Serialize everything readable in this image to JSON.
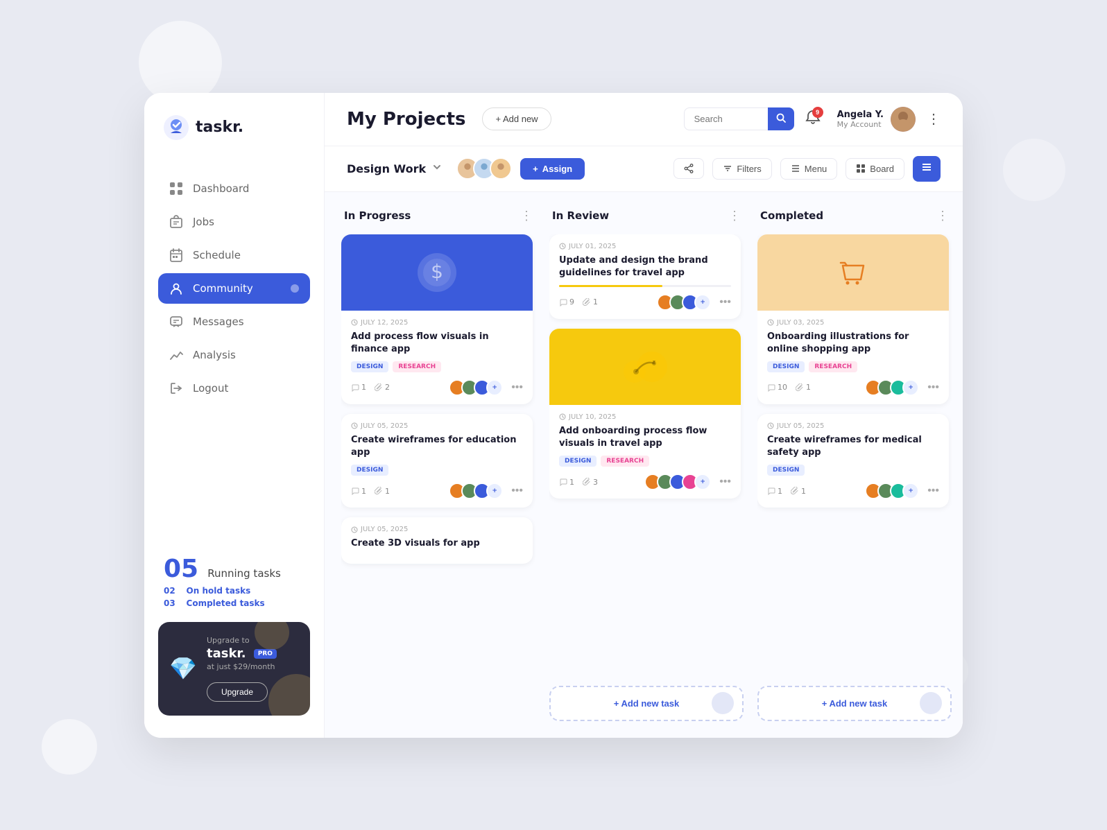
{
  "app": {
    "name": "taskr.",
    "logo_alt": "Taskr logo"
  },
  "header": {
    "page_title": "My Projects",
    "add_new_label": "+ Add new",
    "search_placeholder": "Search",
    "notification_count": "9",
    "user": {
      "name": "Angela Y.",
      "role": "My Account"
    }
  },
  "toolbar": {
    "project_name": "Design Work",
    "assign_label": "Assign",
    "filters_label": "Filters",
    "menu_label": "Menu",
    "board_label": "Board"
  },
  "sidebar": {
    "nav_items": [
      {
        "id": "dashboard",
        "label": "Dashboard",
        "active": false
      },
      {
        "id": "jobs",
        "label": "Jobs",
        "active": false
      },
      {
        "id": "schedule",
        "label": "Schedule",
        "active": false
      },
      {
        "id": "community",
        "label": "Community",
        "active": true
      },
      {
        "id": "messages",
        "label": "Messages",
        "active": false
      },
      {
        "id": "analysis",
        "label": "Analysis",
        "active": false
      },
      {
        "id": "logout",
        "label": "Logout",
        "active": false
      }
    ],
    "running_tasks": {
      "count": "05",
      "label": "Running tasks",
      "on_hold": "02",
      "on_hold_label": "On hold tasks",
      "completed": "03",
      "completed_label": "Completed tasks"
    },
    "upgrade": {
      "pre_text": "Upgrade to",
      "brand": "taskr.",
      "pro_badge": "PRO",
      "price": "at just $29/month",
      "button_label": "Upgrade"
    }
  },
  "columns": [
    {
      "id": "in-progress",
      "title": "In Progress",
      "cards": [
        {
          "id": "card1",
          "has_image": true,
          "image_type": "blue",
          "image_icon": "$",
          "date": "JULY 12, 2025",
          "title": "Add process flow visuals in finance app",
          "tags": [
            "Design",
            "Research"
          ],
          "stats": {
            "comments": "1",
            "attachments": "2"
          },
          "members": 3,
          "has_more": true
        },
        {
          "id": "card2",
          "has_image": false,
          "date": "JULY 05, 2025",
          "title": "Create wireframes for education app",
          "tags": [
            "Design"
          ],
          "stats": {
            "comments": "1",
            "attachments": "1"
          },
          "members": 3,
          "has_more": true
        },
        {
          "id": "card3",
          "has_image": false,
          "date": "JULY 05, 2025",
          "title": "Create 3D visuals for app",
          "tags": [],
          "stats": {},
          "members": 0,
          "has_more": false
        }
      ]
    },
    {
      "id": "in-review",
      "title": "In Review",
      "cards": [
        {
          "id": "card4",
          "has_image": false,
          "date": "JULY 01, 2025",
          "title": "Update and design the brand guidelines for travel app",
          "tags": [],
          "progress": 60,
          "stats": {
            "comments": "9",
            "attachments": "1"
          },
          "members": 3,
          "has_more": true
        },
        {
          "id": "card5",
          "has_image": true,
          "image_type": "yellow",
          "image_icon": "route",
          "date": "JULY 10, 2025",
          "title": "Add onboarding process flow visuals in travel app",
          "tags": [
            "Design",
            "Research"
          ],
          "stats": {
            "comments": "1",
            "attachments": "3"
          },
          "members": 4,
          "has_more": true
        }
      ],
      "add_task_label": "+ Add new task"
    },
    {
      "id": "completed",
      "title": "Completed",
      "cards": [
        {
          "id": "card6",
          "has_image": true,
          "image_type": "orange",
          "image_icon": "🛒",
          "date": "JULY 03, 2025",
          "title": "Onboarding illustrations for online shopping app",
          "tags": [
            "Design",
            "Research"
          ],
          "stats": {
            "comments": "10",
            "attachments": "1"
          },
          "members": 3,
          "has_more": true
        },
        {
          "id": "card7",
          "has_image": false,
          "date": "JULY 05, 2025",
          "title": "Create wireframes for medical safety app",
          "tags": [
            "Design"
          ],
          "stats": {
            "comments": "1",
            "attachments": "1"
          },
          "members": 3,
          "has_more": true
        }
      ],
      "add_task_label": "+ Add new task"
    }
  ]
}
